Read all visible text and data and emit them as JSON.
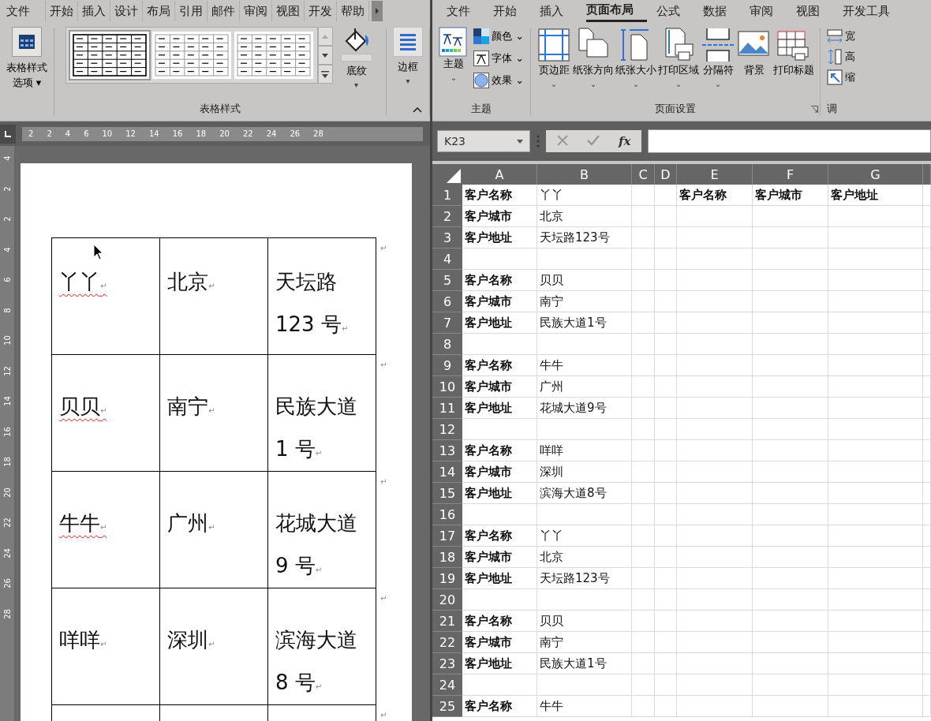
{
  "word": {
    "tabs": [
      {
        "label": "文件",
        "selected": false
      },
      {
        "label": "开始",
        "selected": false
      },
      {
        "label": "插入",
        "selected": false
      },
      {
        "label": "设计",
        "selected": false
      },
      {
        "label": "布局",
        "selected": false
      },
      {
        "label": "引用",
        "selected": false
      },
      {
        "label": "邮件",
        "selected": false
      },
      {
        "label": "审阅",
        "selected": false
      },
      {
        "label": "视图",
        "selected": false
      },
      {
        "label": "开发",
        "selected": false
      },
      {
        "label": "帮助",
        "selected": false
      }
    ],
    "ribbon": {
      "style_options": [
        "表格样式",
        "选项"
      ],
      "style_options_caret": "▾",
      "styles": [
        {
          "selected": true
        },
        {
          "selected": false
        },
        {
          "selected": false
        }
      ],
      "shading": "底纹",
      "shading_caret": "▾",
      "borders": "边框",
      "borders_caret": "▾",
      "group_label": "表格样式"
    },
    "ruler": {
      "numbers": [
        "2",
        "2",
        "4",
        "6",
        "10",
        "12",
        "14",
        "16",
        "18",
        "20",
        "22",
        "24",
        "26",
        "28"
      ]
    },
    "vertical_ruler": {
      "numbers": [
        "4",
        "2",
        "2",
        "4",
        "6",
        "8",
        "10",
        "12",
        "14",
        "16",
        "18",
        "20",
        "22",
        "24",
        "26",
        "28"
      ]
    },
    "table": {
      "rows": [
        {
          "cells": [
            {
              "text": "丫丫",
              "mark": "↵",
              "misspelled": true
            },
            {
              "text": "北京",
              "mark": "↵",
              "misspelled": false
            },
            {
              "text": "天坛路\n123 号",
              "mark": "↵",
              "misspelled": false
            }
          ],
          "end_mark": "↵"
        },
        {
          "cells": [
            {
              "text": "贝贝",
              "mark": "↵",
              "misspelled": true
            },
            {
              "text": "南宁",
              "mark": "↵",
              "misspelled": false
            },
            {
              "text": "民族大道\n1 号",
              "mark": "↵",
              "misspelled": false
            }
          ],
          "end_mark": "↵"
        },
        {
          "cells": [
            {
              "text": "牛牛",
              "mark": "↵",
              "misspelled": true
            },
            {
              "text": "广州",
              "mark": "↵",
              "misspelled": false
            },
            {
              "text": "花城大道\n9 号",
              "mark": "↵",
              "misspelled": false
            }
          ],
          "end_mark": "↵"
        },
        {
          "cells": [
            {
              "text": "咩咩",
              "mark": "↵",
              "misspelled": false
            },
            {
              "text": "深圳",
              "mark": "↵",
              "misspelled": false
            },
            {
              "text": "滨海大道\n8 号",
              "mark": "↵",
              "misspelled": false
            }
          ],
          "end_mark": "↵"
        }
      ],
      "cut_row": {
        "end_mark": "↵"
      }
    }
  },
  "excel": {
    "tabs": [
      {
        "label": "文件",
        "selected": false
      },
      {
        "label": "开始",
        "selected": false
      },
      {
        "label": "插入",
        "selected": false
      },
      {
        "label": "页面布局",
        "selected": true
      },
      {
        "label": "公式",
        "selected": false
      },
      {
        "label": "数据",
        "selected": false
      },
      {
        "label": "审阅",
        "selected": false
      },
      {
        "label": "视图",
        "selected": false
      },
      {
        "label": "开发工具",
        "selected": false
      }
    ],
    "theme_group": {
      "theme": "主题",
      "theme_caret": "⌄",
      "colors": "颜色 ⌄",
      "fonts": "字体 ⌄",
      "effects": "效果 ⌄",
      "label": "主题"
    },
    "page_setup": {
      "buttons": [
        {
          "kind": "margins",
          "label": "页边距",
          "caret": "⌄"
        },
        {
          "kind": "orientation",
          "label": "纸张方向",
          "caret": "⌄"
        },
        {
          "kind": "size",
          "label": "纸张大小",
          "caret": "⌄"
        },
        {
          "kind": "print_area",
          "label": "打印区域",
          "caret": "⌄"
        },
        {
          "kind": "breaks",
          "label": "分隔符",
          "caret": "⌄"
        },
        {
          "kind": "background",
          "label": "背景"
        },
        {
          "kind": "print_titles",
          "label": "打印标题"
        }
      ],
      "label": "页面设置"
    },
    "scale_group": {
      "items": [
        "宽",
        "高",
        "缩"
      ],
      "label": "调"
    },
    "name_box": "K23",
    "fx": "fx",
    "columns": [
      "A",
      "B",
      "C",
      "D",
      "E",
      "F",
      "G"
    ],
    "rows": [
      {
        "number": "1",
        "cells": [
          {
            "text": "客户名称",
            "bold": true
          },
          {
            "text": "丫丫",
            "bold": false
          },
          {
            "text": ""
          },
          {
            "text": ""
          },
          {
            "text": "客户名称",
            "bold": true
          },
          {
            "text": "客户城市",
            "bold": true
          },
          {
            "text": "客户地址",
            "bold": true
          }
        ]
      },
      {
        "number": "2",
        "cells": [
          {
            "text": "客户城市",
            "bold": true
          },
          {
            "text": "北京",
            "bold": false
          }
        ]
      },
      {
        "number": "3",
        "cells": [
          {
            "text": "客户地址",
            "bold": true
          },
          {
            "text": "天坛路123号",
            "bold": false
          }
        ]
      },
      {
        "number": "4",
        "cells": []
      },
      {
        "number": "5",
        "cells": [
          {
            "text": "客户名称",
            "bold": true
          },
          {
            "text": "贝贝",
            "bold": false
          }
        ]
      },
      {
        "number": "6",
        "cells": [
          {
            "text": "客户城市",
            "bold": true
          },
          {
            "text": "南宁",
            "bold": false
          }
        ]
      },
      {
        "number": "7",
        "cells": [
          {
            "text": "客户地址",
            "bold": true
          },
          {
            "text": "民族大道1号",
            "bold": false
          }
        ]
      },
      {
        "number": "8",
        "cells": []
      },
      {
        "number": "9",
        "cells": [
          {
            "text": "客户名称",
            "bold": true
          },
          {
            "text": "牛牛",
            "bold": false
          }
        ]
      },
      {
        "number": "10",
        "cells": [
          {
            "text": "客户城市",
            "bold": true
          },
          {
            "text": "广州",
            "bold": false
          }
        ]
      },
      {
        "number": "11",
        "cells": [
          {
            "text": "客户地址",
            "bold": true
          },
          {
            "text": "花城大道9号",
            "bold": false
          }
        ]
      },
      {
        "number": "12",
        "cells": []
      },
      {
        "number": "13",
        "cells": [
          {
            "text": "客户名称",
            "bold": true
          },
          {
            "text": "咩咩",
            "bold": false
          }
        ]
      },
      {
        "number": "14",
        "cells": [
          {
            "text": "客户城市",
            "bold": true
          },
          {
            "text": "深圳",
            "bold": false
          }
        ]
      },
      {
        "number": "15",
        "cells": [
          {
            "text": "客户地址",
            "bold": true
          },
          {
            "text": "滨海大道8号",
            "bold": false
          }
        ]
      },
      {
        "number": "16",
        "cells": []
      },
      {
        "number": "17",
        "cells": [
          {
            "text": "客户名称",
            "bold": true
          },
          {
            "text": "丫丫",
            "bold": false
          }
        ]
      },
      {
        "number": "18",
        "cells": [
          {
            "text": "客户城市",
            "bold": true
          },
          {
            "text": "北京",
            "bold": false
          }
        ]
      },
      {
        "number": "19",
        "cells": [
          {
            "text": "客户地址",
            "bold": true
          },
          {
            "text": "天坛路123号",
            "bold": false
          }
        ]
      },
      {
        "number": "20",
        "cells": []
      },
      {
        "number": "21",
        "cells": [
          {
            "text": "客户名称",
            "bold": true
          },
          {
            "text": "贝贝",
            "bold": false
          }
        ]
      },
      {
        "number": "22",
        "cells": [
          {
            "text": "客户城市",
            "bold": true
          },
          {
            "text": "南宁",
            "bold": false
          }
        ]
      },
      {
        "number": "23",
        "cells": [
          {
            "text": "客户地址",
            "bold": true
          },
          {
            "text": "民族大道1号",
            "bold": false
          }
        ]
      },
      {
        "number": "24",
        "cells": []
      },
      {
        "number": "25",
        "cells": [
          {
            "text": "客户名称",
            "bold": true
          },
          {
            "text": "牛牛",
            "bold": false
          }
        ]
      }
    ]
  }
}
